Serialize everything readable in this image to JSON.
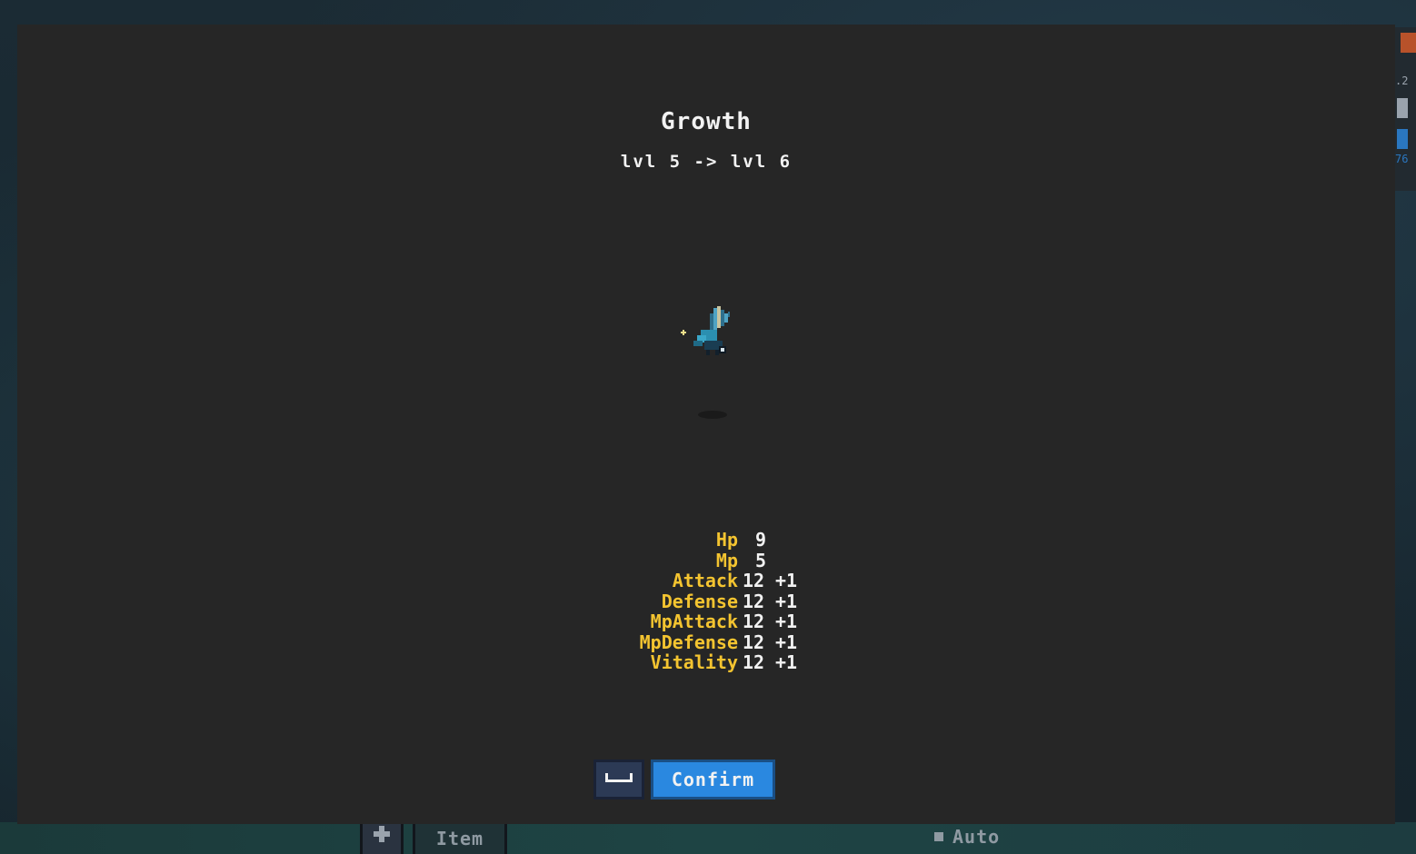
{
  "dialog": {
    "title": "Growth",
    "level_change": "lvl 5 -> lvl 6"
  },
  "creature": {
    "sprite": "blue-winged-creature-sprite"
  },
  "stats": [
    {
      "name": "Hp",
      "value": "9",
      "bonus": ""
    },
    {
      "name": "Mp",
      "value": "5",
      "bonus": ""
    },
    {
      "name": "Attack",
      "value": "12",
      "bonus": "+1"
    },
    {
      "name": "Defense",
      "value": "12",
      "bonus": "+1"
    },
    {
      "name": "MpAttack",
      "value": "12",
      "bonus": "+1"
    },
    {
      "name": "MpDefense",
      "value": "12",
      "bonus": "+1"
    },
    {
      "name": "Vitality",
      "value": "12",
      "bonus": "+1"
    }
  ],
  "actions": {
    "key_hint_icon": "spacebar-key-icon",
    "confirm_label": "Confirm"
  },
  "background": {
    "item_label": "Item",
    "auto_label": "Auto",
    "side_label_1": ".2",
    "side_label_2": "76"
  },
  "colors": {
    "stat_name": "#f4c430",
    "confirm_button": "#2a88e0",
    "dialog_bg": "#262626"
  }
}
